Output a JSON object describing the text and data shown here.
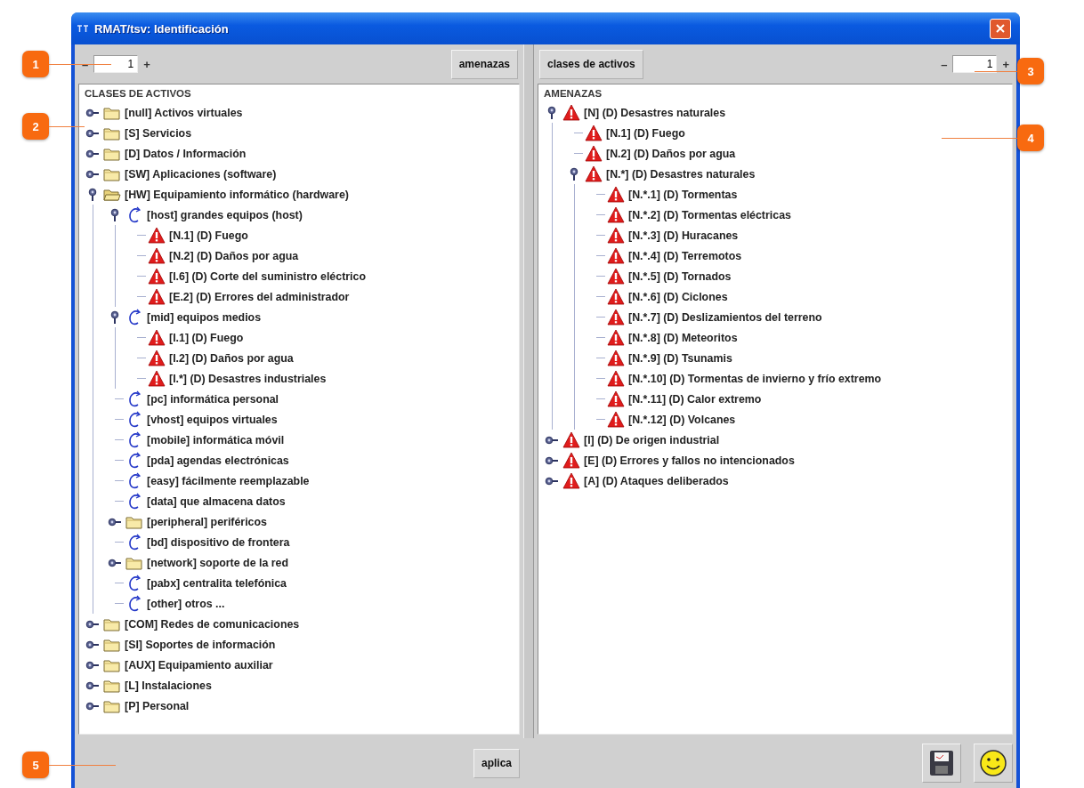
{
  "callouts": [
    {
      "label": "1"
    },
    {
      "label": "2"
    },
    {
      "label": "3"
    },
    {
      "label": "4"
    },
    {
      "label": "5"
    }
  ],
  "window": {
    "title": "RMAT/tsv: Identificación"
  },
  "left_pane": {
    "spinner": {
      "minus": "–",
      "value": "1",
      "plus": "+"
    },
    "button": "amenazas",
    "heading": "CLASES DE ACTIVOS",
    "tree": [
      {
        "label": "[null] Activos virtuales",
        "kind": "folder",
        "expanded": false
      },
      {
        "label": "[S] Servicios",
        "kind": "folder",
        "expanded": false
      },
      {
        "label": "[D] Datos / Información",
        "kind": "folder",
        "expanded": false
      },
      {
        "label": "[SW] Aplicaciones (software)",
        "kind": "folder",
        "expanded": false
      },
      {
        "label": "[HW] Equipamiento informático (hardware)",
        "kind": "folder",
        "expanded": true,
        "children": [
          {
            "label": "[host] grandes equipos (host)",
            "kind": "class",
            "expanded": true,
            "children": [
              {
                "label": "[N.1] (D) Fuego",
                "kind": "threat"
              },
              {
                "label": "[N.2] (D) Daños por agua",
                "kind": "threat"
              },
              {
                "label": "[I.6] (D) Corte del suministro eléctrico",
                "kind": "threat"
              },
              {
                "label": "[E.2] (D) Errores del administrador",
                "kind": "threat"
              }
            ]
          },
          {
            "label": "[mid] equipos medios",
            "kind": "class",
            "expanded": true,
            "children": [
              {
                "label": "[I.1] (D) Fuego",
                "kind": "threat"
              },
              {
                "label": "[I.2] (D) Daños por agua",
                "kind": "threat"
              },
              {
                "label": "[I.*] (D) Desastres industriales",
                "kind": "threat"
              }
            ]
          },
          {
            "label": "[pc] informática personal",
            "kind": "class"
          },
          {
            "label": "[vhost] equipos virtuales",
            "kind": "class"
          },
          {
            "label": "[mobile] informática móvil",
            "kind": "class"
          },
          {
            "label": "[pda] agendas electrónicas",
            "kind": "class"
          },
          {
            "label": "[easy] fácilmente reemplazable",
            "kind": "class"
          },
          {
            "label": "[data] que almacena datos",
            "kind": "class"
          },
          {
            "label": "[peripheral] periféricos",
            "kind": "folder",
            "expanded": false
          },
          {
            "label": "[bd] dispositivo de frontera",
            "kind": "class"
          },
          {
            "label": "[network] soporte de la red",
            "kind": "folder",
            "expanded": false
          },
          {
            "label": "[pabx] centralita telefónica",
            "kind": "class"
          },
          {
            "label": "[other] otros ...",
            "kind": "class"
          }
        ]
      },
      {
        "label": "[COM] Redes de comunicaciones",
        "kind": "folder",
        "expanded": false
      },
      {
        "label": "[SI] Soportes de información",
        "kind": "folder",
        "expanded": false
      },
      {
        "label": "[AUX] Equipamiento auxiliar",
        "kind": "folder",
        "expanded": false
      },
      {
        "label": "[L] Instalaciones",
        "kind": "folder",
        "expanded": false
      },
      {
        "label": "[P] Personal",
        "kind": "folder",
        "expanded": false
      }
    ]
  },
  "right_pane": {
    "button": "clases de activos",
    "spinner": {
      "minus": "–",
      "value": "1",
      "plus": "+"
    },
    "heading": "AMENAZAS",
    "tree": [
      {
        "label": "[N] (D) Desastres naturales",
        "kind": "threat",
        "expanded": true,
        "children": [
          {
            "label": "[N.1] (D) Fuego",
            "kind": "threat"
          },
          {
            "label": "[N.2] (D) Daños por agua",
            "kind": "threat"
          },
          {
            "label": "[N.*] (D) Desastres naturales",
            "kind": "threat",
            "expanded": true,
            "children": [
              {
                "label": "[N.*.1] (D) Tormentas",
                "kind": "threat"
              },
              {
                "label": "[N.*.2] (D) Tormentas eléctricas",
                "kind": "threat"
              },
              {
                "label": "[N.*.3] (D) Huracanes",
                "kind": "threat"
              },
              {
                "label": "[N.*.4] (D) Terremotos",
                "kind": "threat"
              },
              {
                "label": "[N.*.5] (D) Tornados",
                "kind": "threat"
              },
              {
                "label": "[N.*.6] (D) Ciclones",
                "kind": "threat"
              },
              {
                "label": "[N.*.7] (D) Deslizamientos del terreno",
                "kind": "threat"
              },
              {
                "label": "[N.*.8] (D) Meteoritos",
                "kind": "threat"
              },
              {
                "label": "[N.*.9] (D) Tsunamis",
                "kind": "threat"
              },
              {
                "label": "[N.*.10] (D) Tormentas de invierno y frío extremo",
                "kind": "threat"
              },
              {
                "label": "[N.*.11] (D) Calor extremo",
                "kind": "threat"
              },
              {
                "label": "[N.*.12] (D) Volcanes",
                "kind": "threat"
              }
            ]
          }
        ]
      },
      {
        "label": "[I] (D) De origen industrial",
        "kind": "threat",
        "expanded": false
      },
      {
        "label": "[E] (D) Errores y fallos no intencionados",
        "kind": "threat",
        "expanded": false
      },
      {
        "label": "[A] (D) Ataques deliberados",
        "kind": "threat",
        "expanded": false
      }
    ]
  },
  "bottom_bar": {
    "apply_button": "aplica"
  }
}
